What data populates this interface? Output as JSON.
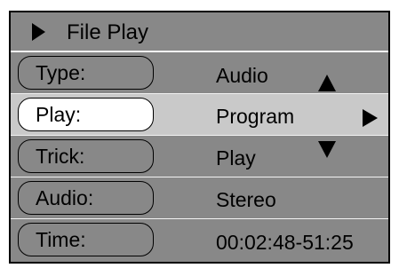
{
  "menu": {
    "title": "File Play",
    "rows": [
      {
        "label": "Type:",
        "value": "Audio",
        "selected": false
      },
      {
        "label": "Play:",
        "value": "Program",
        "selected": true
      },
      {
        "label": "Trick:",
        "value": "Play",
        "selected": false
      },
      {
        "label": "Audio:",
        "value": "Stereo",
        "selected": false
      },
      {
        "label": "Time:",
        "value": "00:02:48-51:25",
        "selected": false
      }
    ]
  },
  "colors": {
    "panel_bg": "#888888",
    "selected_row_bg": "#c9c9c9",
    "selected_pill_bg": "#ffffff",
    "border": "#000000",
    "row_divider": "#f2f2f2"
  },
  "icons": {
    "title": "play-triangle-icon",
    "scroll_up": "up-arrow-icon",
    "scroll_down": "down-arrow-icon",
    "next_option": "right-arrow-icon"
  }
}
